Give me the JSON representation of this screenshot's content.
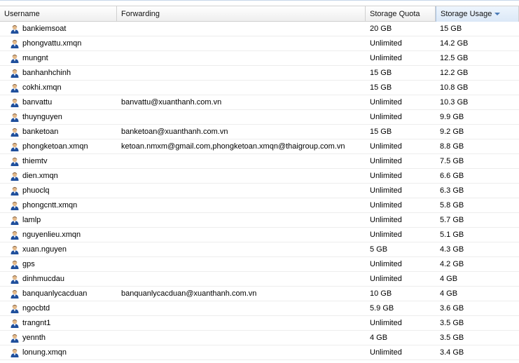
{
  "columns": {
    "username": "Username",
    "forwarding": "Forwarding",
    "storage_quota": "Storage Quota",
    "storage_usage": "Storage Usage"
  },
  "sort": {
    "column": "storage_usage",
    "direction": "descending"
  },
  "row_icon": "user-icon",
  "rows": [
    {
      "username": "bankiemsoat",
      "forwarding": "",
      "quota": "20 GB",
      "usage": "15 GB"
    },
    {
      "username": "phongvattu.xmqn",
      "forwarding": "",
      "quota": "Unlimited",
      "usage": "14.2 GB"
    },
    {
      "username": "mungnt",
      "forwarding": "",
      "quota": "Unlimited",
      "usage": "12.5 GB"
    },
    {
      "username": "banhanhchinh",
      "forwarding": "",
      "quota": "15 GB",
      "usage": "12.2 GB"
    },
    {
      "username": "cokhi.xmqn",
      "forwarding": "",
      "quota": "15 GB",
      "usage": "10.8 GB"
    },
    {
      "username": "banvattu",
      "forwarding": "banvattu@xuanthanh.com.vn",
      "quota": "Unlimited",
      "usage": "10.3 GB"
    },
    {
      "username": "thuynguyen",
      "forwarding": "",
      "quota": "Unlimited",
      "usage": "9.9 GB"
    },
    {
      "username": "banketoan",
      "forwarding": "banketoan@xuanthanh.com.vn",
      "quota": "15 GB",
      "usage": "9.2 GB"
    },
    {
      "username": "phongketoan.xmqn",
      "forwarding": "ketoan.nmxm@gmail.com,phongketoan.xmqn@thaigroup.com.vn",
      "quota": "Unlimited",
      "usage": "8.8 GB"
    },
    {
      "username": "thiemtv",
      "forwarding": "",
      "quota": "Unlimited",
      "usage": "7.5 GB"
    },
    {
      "username": "dien.xmqn",
      "forwarding": "",
      "quota": "Unlimited",
      "usage": "6.6 GB"
    },
    {
      "username": "phuoclq",
      "forwarding": "",
      "quota": "Unlimited",
      "usage": "6.3 GB"
    },
    {
      "username": "phongcntt.xmqn",
      "forwarding": "",
      "quota": "Unlimited",
      "usage": "5.8 GB"
    },
    {
      "username": "lamlp",
      "forwarding": "",
      "quota": "Unlimited",
      "usage": "5.7 GB"
    },
    {
      "username": "nguyenlieu.xmqn",
      "forwarding": "",
      "quota": "Unlimited",
      "usage": "5.1 GB"
    },
    {
      "username": "xuan.nguyen",
      "forwarding": "",
      "quota": "5 GB",
      "usage": "4.3 GB"
    },
    {
      "username": "gps",
      "forwarding": "",
      "quota": "Unlimited",
      "usage": "4.2 GB"
    },
    {
      "username": "dinhmucdau",
      "forwarding": "",
      "quota": "Unlimited",
      "usage": "4 GB"
    },
    {
      "username": "banquanlycacduan",
      "forwarding": "banquanlycacduan@xuanthanh.com.vn",
      "quota": "10 GB",
      "usage": "4 GB"
    },
    {
      "username": "ngocbtd",
      "forwarding": "",
      "quota": "5.9 GB",
      "usage": "3.6 GB"
    },
    {
      "username": "trangnt1",
      "forwarding": "",
      "quota": "Unlimited",
      "usage": "3.5 GB"
    },
    {
      "username": "yennth",
      "forwarding": "",
      "quota": "4 GB",
      "usage": "3.5 GB"
    },
    {
      "username": "lonung.xmqn",
      "forwarding": "",
      "quota": "Unlimited",
      "usage": "3.4 GB"
    }
  ]
}
